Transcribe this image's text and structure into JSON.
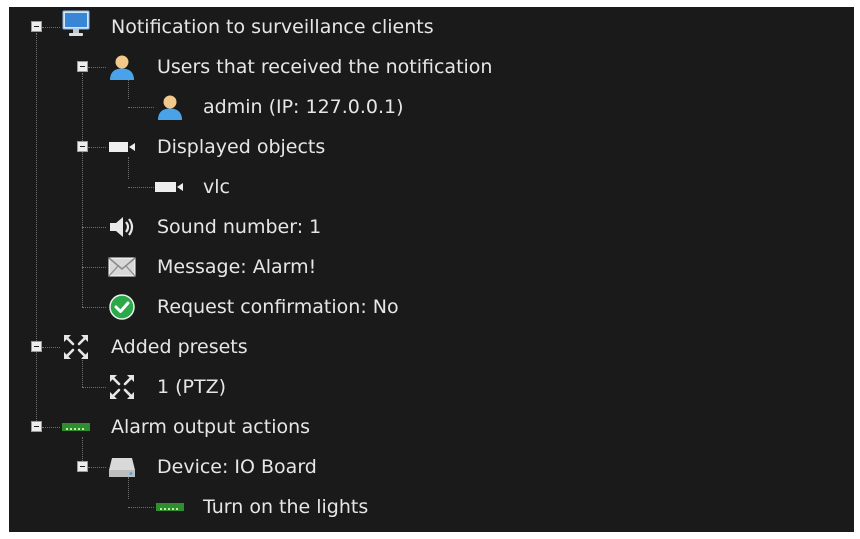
{
  "tree": {
    "monitor_node": {
      "label": "Notification to surveillance clients",
      "icon": "monitor-icon",
      "children": {
        "users_node": {
          "label": "Users that received the notification",
          "icon": "user-icon"
        },
        "admin_node": {
          "label": "admin (IP: 127.0.0.1)",
          "icon": "user-icon"
        },
        "displayed_node": {
          "label": "Displayed objects",
          "icon": "camera-icon"
        },
        "vlc_node": {
          "label": "vlc",
          "icon": "camera-icon"
        },
        "sound_node": {
          "label": "Sound number: 1",
          "icon": "speaker-icon"
        },
        "message_node": {
          "label": "Message: Alarm!",
          "icon": "envelope-icon"
        },
        "confirm_node": {
          "label": "Request confirmation: No",
          "icon": "check-circle-icon"
        }
      }
    },
    "presets_node": {
      "label": "Added presets",
      "icon": "ptz-icon",
      "children": {
        "preset_1": {
          "label": "1 (PTZ)",
          "icon": "ptz-icon"
        }
      }
    },
    "alarm_node": {
      "label": "Alarm output actions",
      "icon": "relay-icon",
      "children": {
        "device_node": {
          "label": "Device: IO Board",
          "icon": "device-icon"
        },
        "lights_node": {
          "label": "Turn on the lights",
          "icon": "relay-icon"
        }
      }
    }
  },
  "colors": {
    "background": "#1a1a1a",
    "text": "#e6e6e6",
    "user_blue": "#4aa3e8",
    "check_green": "#2aa84a",
    "relay_green": "#2f8f2f"
  }
}
